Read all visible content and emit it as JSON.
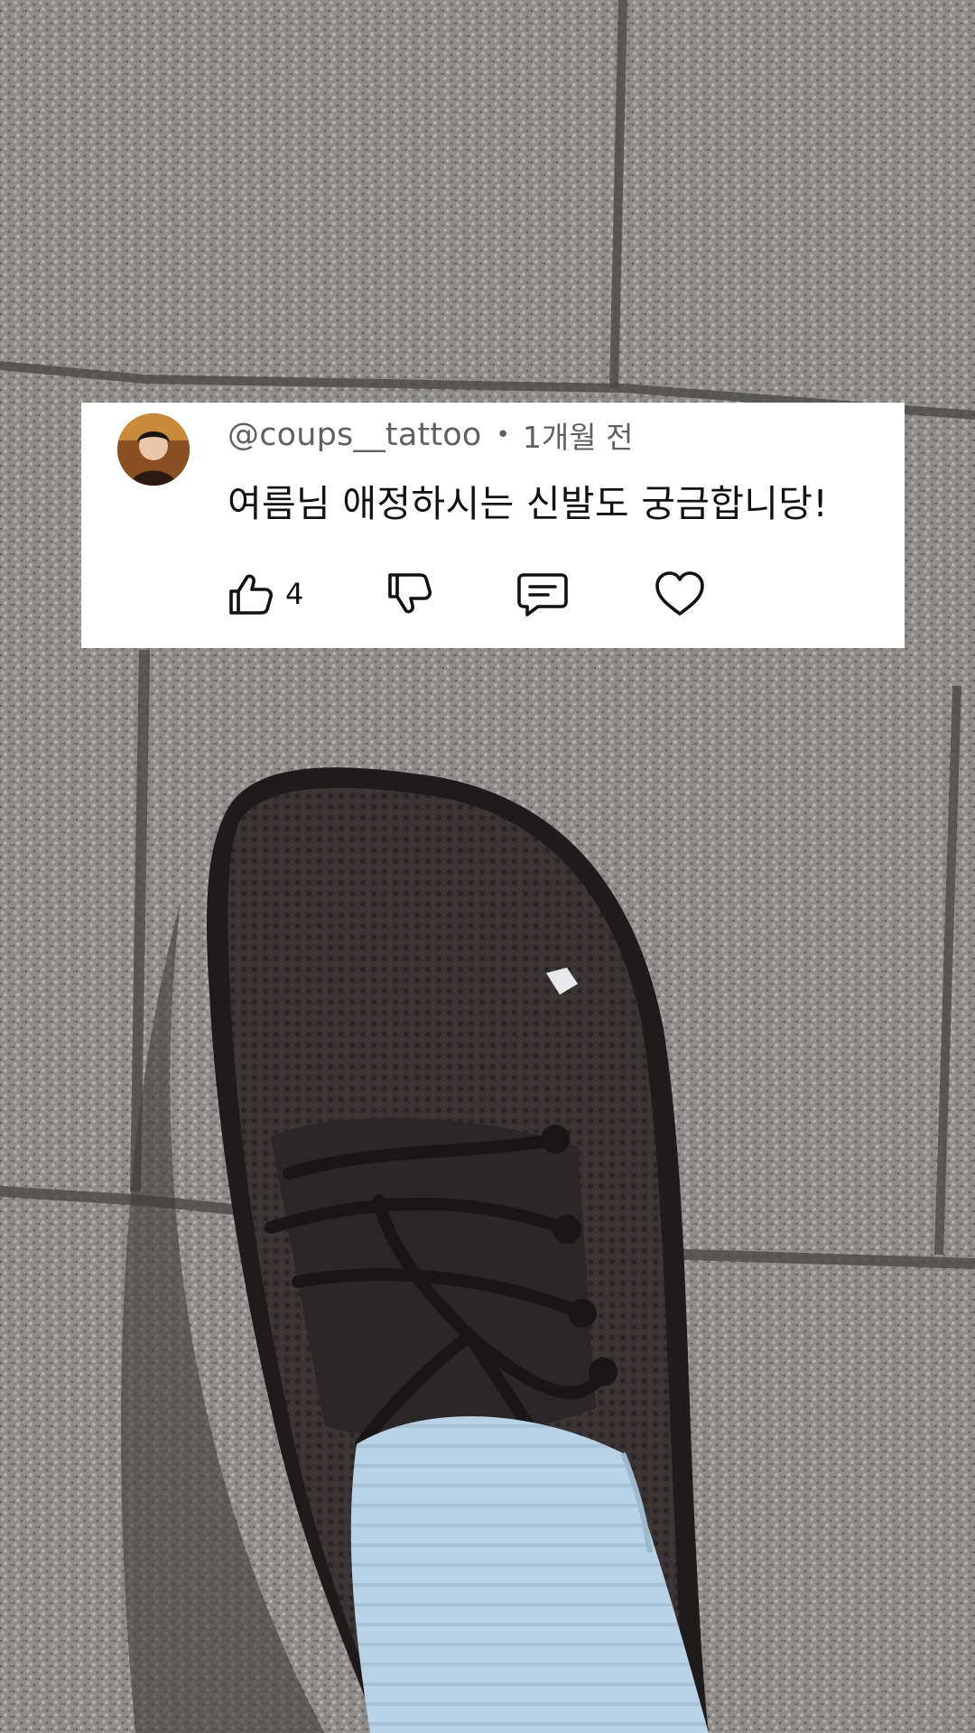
{
  "comment": {
    "avatar_icon": "user-avatar",
    "handle": "@coups__tattoo",
    "separator": "•",
    "time_ago": "1개월 전",
    "text": "여름님 애정하시는 신발도 궁금합니당!",
    "like_count": "4",
    "icons": {
      "like": "thumbs-up-icon",
      "dislike": "thumbs-down-icon",
      "reply": "reply-icon",
      "heart": "heart-icon"
    }
  },
  "colors": {
    "card_background": "#ffffff",
    "meta_text": "#606060",
    "comment_text": "#111111",
    "sock": "#b9d2e6",
    "shoe": "#3a3435",
    "pavement": "#8a8886"
  }
}
